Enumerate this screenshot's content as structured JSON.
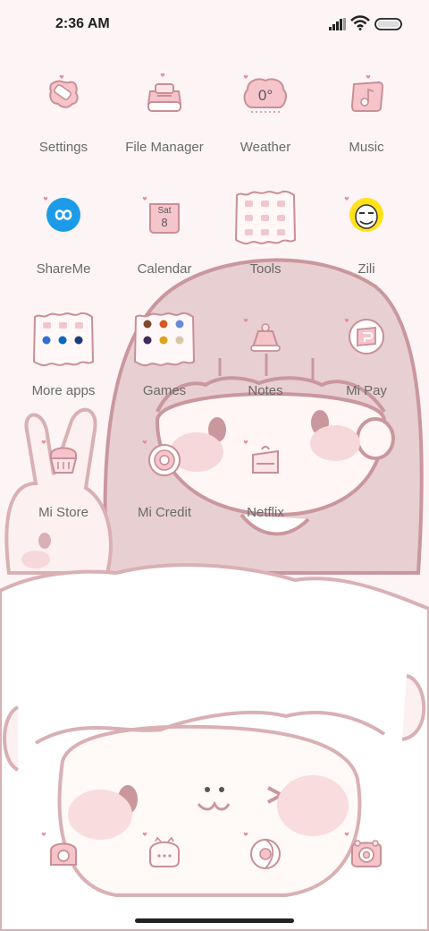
{
  "status_bar": {
    "time": "2:36 AM"
  },
  "theme": {
    "accent": "#e8a8b2",
    "line": "#c98f96",
    "label_color": "#6a6a6a"
  },
  "home_apps": [
    {
      "label": "Settings",
      "icon": "settings-icon"
    },
    {
      "label": "File Manager",
      "icon": "file-manager-icon"
    },
    {
      "label": "Weather",
      "icon": "weather-icon",
      "badge": "0°"
    },
    {
      "label": "Music",
      "icon": "music-icon"
    },
    {
      "label": "ShareMe",
      "icon": "shareme-icon"
    },
    {
      "label": "Calendar",
      "icon": "calendar-icon",
      "day": "Sat",
      "date": "8"
    },
    {
      "label": "Tools",
      "icon": "folder-icon"
    },
    {
      "label": "Zili",
      "icon": "zili-icon"
    },
    {
      "label": "More apps",
      "icon": "folder-icon"
    },
    {
      "label": "Games",
      "icon": "folder-icon"
    },
    {
      "label": "Notes",
      "icon": "notes-icon"
    },
    {
      "label": "Mi Pay",
      "icon": "mi-pay-icon"
    },
    {
      "label": "Mi Store",
      "icon": "mi-store-icon"
    },
    {
      "label": "Mi Credit",
      "icon": "mi-credit-icon"
    },
    {
      "label": "Netflix",
      "icon": "netflix-icon"
    }
  ],
  "dock_apps": [
    {
      "icon": "phone-icon"
    },
    {
      "icon": "messages-icon"
    },
    {
      "icon": "browser-icon"
    },
    {
      "icon": "camera-icon"
    }
  ]
}
